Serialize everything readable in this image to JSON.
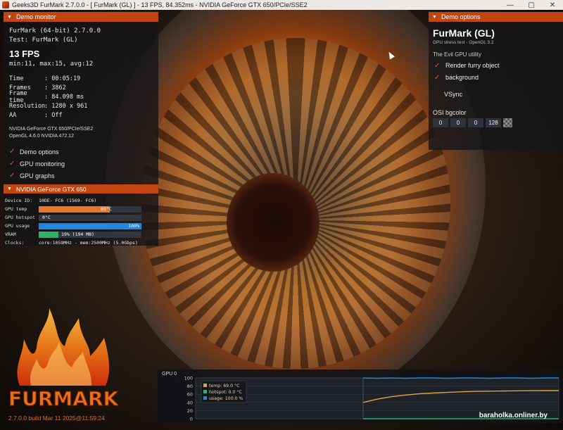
{
  "window": {
    "title": "Geeks3D FurMark 2.7.0.0 - [ FurMark (GL) ] - 13 FPS, 84.352ms - NVIDIA GeForce GTX 650/PCIe/SSE2",
    "minimize": "—",
    "maximize": "▢",
    "close": "✕"
  },
  "demo_monitor": {
    "header": "Demo monitor",
    "app": "FurMark (64-bit) 2.7.0.0",
    "test": "Test: FurMark (GL)",
    "fps": "13 FPS",
    "minmax": "min:11, max:15, avg:12",
    "stats": [
      {
        "k": "Time",
        "v": ": 00:05:19"
      },
      {
        "k": "Frames",
        "v": ": 3862"
      },
      {
        "k": "Frame time",
        "v": ": 84.098 ms"
      },
      {
        "k": "Resolution",
        "v": ": 1280 x 961"
      },
      {
        "k": "AA",
        "v": ": Off"
      }
    ],
    "gpu_line1": "NVIDIA GeForce GTX 650/PCIe/SSE2",
    "gpu_line2": "OpenGL 4.6.0 NVIDIA 472.12",
    "checks": [
      "Demo options",
      "GPU monitoring",
      "GPU graphs"
    ],
    "check_mark": "✓"
  },
  "gpu_monitor": {
    "header": "NVIDIA GeForce GTX 650",
    "device_id_label": "Device ID:",
    "device_id_value": "10DE- FC6 (1569- FC6)",
    "temp_label": "GPU temp",
    "temp_value": "69°C",
    "temp_fraction": 0.69,
    "hotspot_label": "GPU hotspot",
    "hotspot_value": "0°C",
    "hotspot_fraction": 0.0,
    "usage_label": "GPU usage",
    "usage_value": "100%",
    "usage_fraction": 1.0,
    "vram_label": "VRAM",
    "vram_value": "19% (194 MB)",
    "vram_fraction": 0.19,
    "clocks_label": "Clocks:",
    "clocks_value": "core:1059MHz - mem:2500MHz (5.0Gbps)",
    "colors": {
      "temp": "#e8762a",
      "usage": "#1e88e5",
      "vram": "#2bb36a"
    }
  },
  "demo_options": {
    "header": "Demo options",
    "title": "FurMark (GL)",
    "subtitle": "GPU stress test - OpenGL 3.2",
    "evil": "The Evil GPU utility",
    "render_furry": "Render furry object",
    "background": "background",
    "vsync": "VSync",
    "osi_label": "OSI bgcolor",
    "osi_values": [
      "0",
      "0",
      "0",
      "128"
    ],
    "check_mark": "✓"
  },
  "chart_data": {
    "type": "line",
    "title": "GPU 0",
    "ylim": [
      0,
      100
    ],
    "yticks": [
      "100",
      "80",
      "60",
      "40",
      "20",
      "0"
    ],
    "legend": [
      {
        "name": "temp: 69.0 °C",
        "color": "#e8a23a"
      },
      {
        "name": "hotspot: 0.0 °C",
        "color": "#2bb36a"
      },
      {
        "name": "usage: 100.0 %",
        "color": "#1e88e5"
      }
    ],
    "series": [
      {
        "name": "temp",
        "values": [
          40,
          48,
          54,
          58,
          61,
          63,
          64.5,
          66,
          67,
          67.5,
          68,
          68.5,
          68.8,
          69,
          69
        ]
      },
      {
        "name": "hotspot",
        "values": [
          0,
          0,
          0,
          0,
          0,
          0,
          0,
          0,
          0,
          0,
          0,
          0,
          0,
          0,
          0
        ]
      },
      {
        "name": "usage",
        "values": [
          100,
          99,
          100,
          99,
          100,
          100,
          99,
          100,
          100,
          99,
          100,
          100,
          99,
          100,
          100
        ]
      }
    ],
    "grid": true
  },
  "footer": {
    "logo_text": "FURMARK",
    "version": "2.7.0.0 build Mar 11 2025@11:59:24",
    "watermark": "baraholka.onliner.by"
  }
}
